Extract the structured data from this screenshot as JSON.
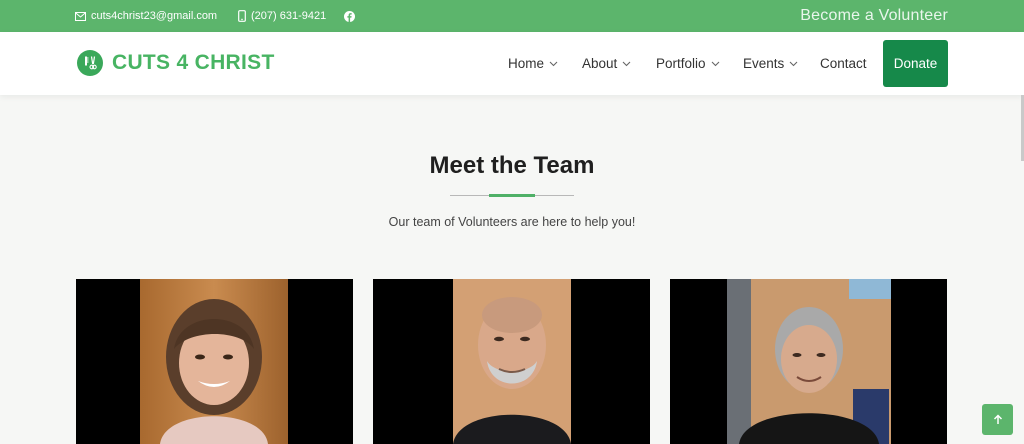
{
  "topbar": {
    "email": "cuts4christ23@gmail.com",
    "phone": "(207) 631-9421",
    "volunteer_link": "Become a Volunteer"
  },
  "brand": {
    "name": "CUTS 4 CHRIST"
  },
  "nav": {
    "items": [
      {
        "label": "Home",
        "has_dropdown": true
      },
      {
        "label": "About",
        "has_dropdown": true
      },
      {
        "label": "Portfolio",
        "has_dropdown": true
      },
      {
        "label": "Events",
        "has_dropdown": true
      },
      {
        "label": "Contact",
        "has_dropdown": false
      }
    ],
    "donate_label": "Donate"
  },
  "team": {
    "title": "Meet the Team",
    "subtitle": "Our team of Volunteers are here to help you!"
  },
  "colors": {
    "topbar": "#5cb56c",
    "brand_green": "#48b463",
    "donate": "#16894a"
  },
  "icons": [
    "envelope-icon",
    "mobile-phone-icon",
    "facebook-icon",
    "scissors-comb-logo-icon",
    "chevron-down-icon",
    "arrow-up-icon"
  ]
}
